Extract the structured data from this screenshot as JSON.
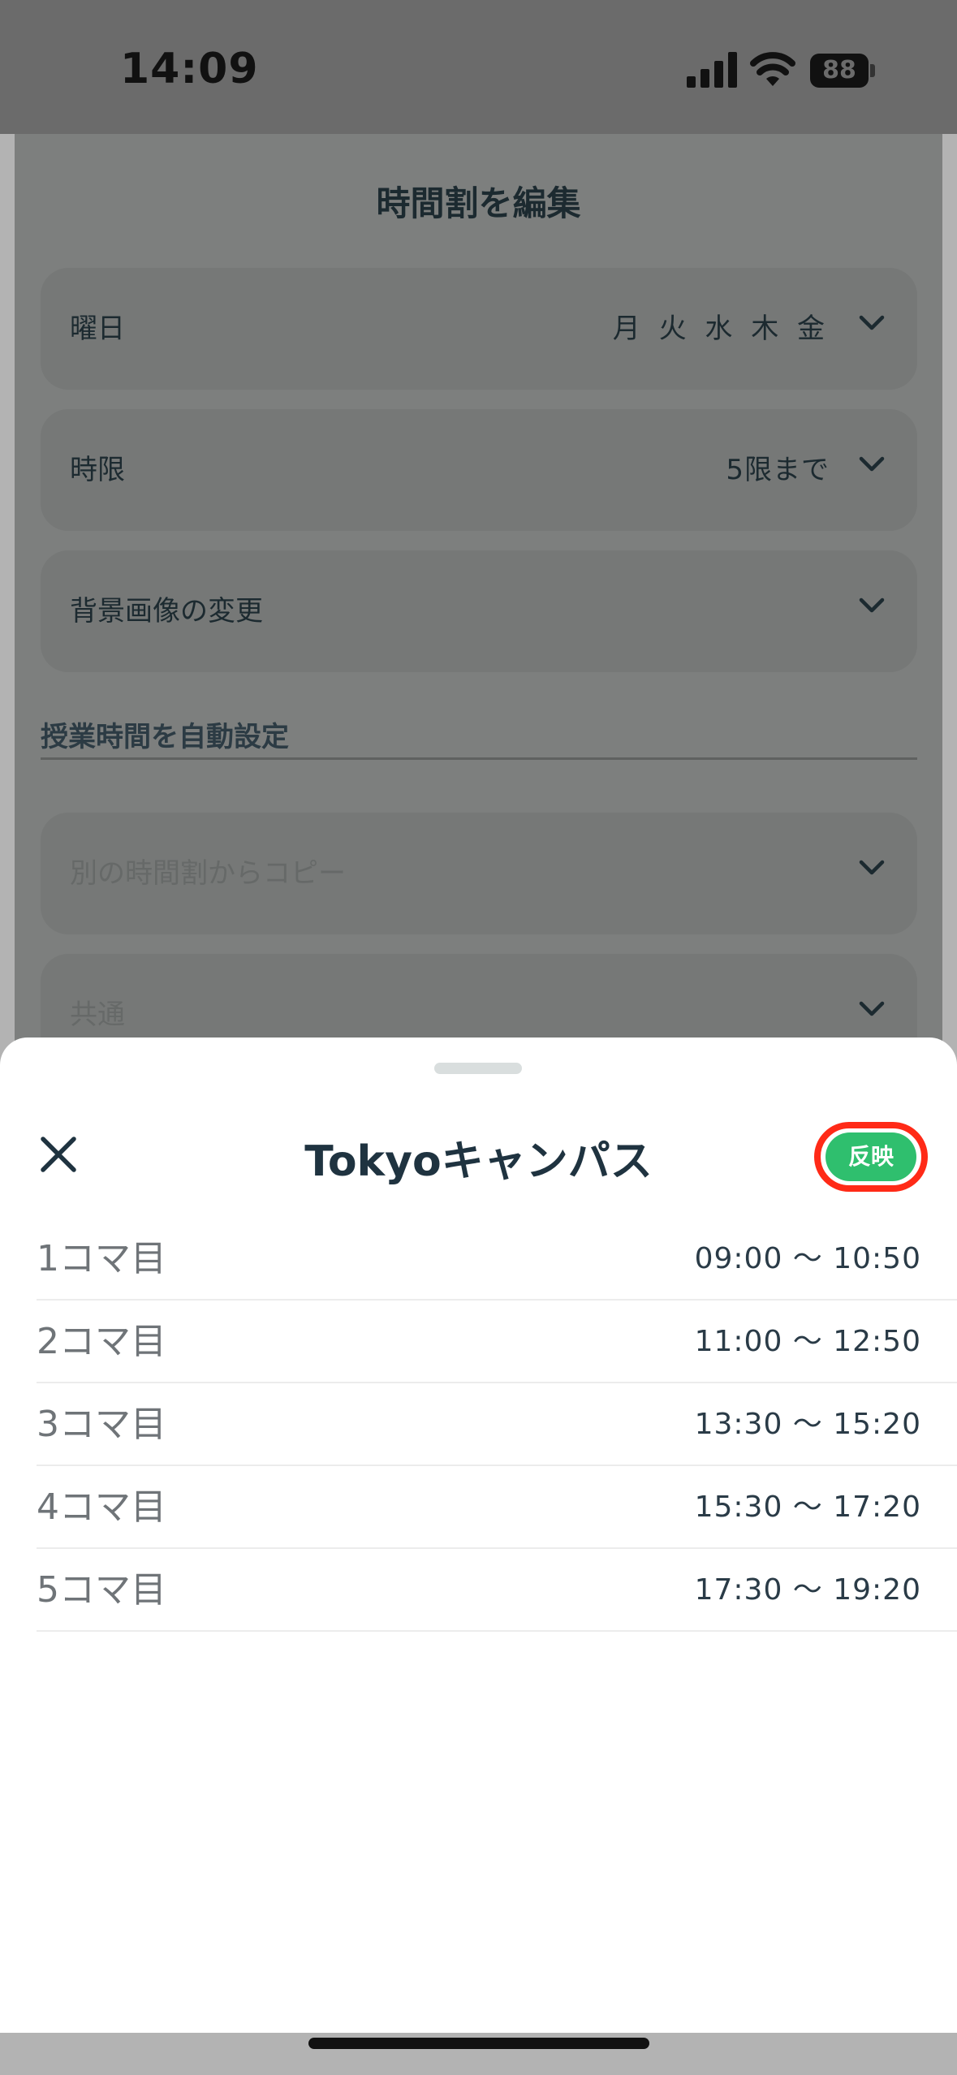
{
  "status_bar": {
    "time": "14:09",
    "battery": "88"
  },
  "page": {
    "title": "時間割を編集",
    "rows": [
      {
        "label": "曜日",
        "value": "月 火 水 木 金"
      },
      {
        "label": "時限",
        "value": "5限まで"
      },
      {
        "label": "背景画像の変更",
        "value": ""
      }
    ],
    "section_header": "授業時間を自動設定",
    "auto_rows": [
      {
        "label": "別の時間割からコピー"
      },
      {
        "label": "共通"
      }
    ]
  },
  "sheet": {
    "title": "Tokyoキャンパス",
    "apply_label": "反映",
    "periods": [
      {
        "name": "1コマ目",
        "time": "09:00 ～ 10:50"
      },
      {
        "name": "2コマ目",
        "time": "11:00 ～ 12:50"
      },
      {
        "name": "3コマ目",
        "time": "13:30 ～ 15:20"
      },
      {
        "name": "4コマ目",
        "time": "15:30 ～ 17:20"
      },
      {
        "name": "5コマ目",
        "time": "17:30 ～ 19:20"
      }
    ]
  },
  "colors": {
    "apply_button": "#2fbf6e",
    "highlight_ring": "#ff2a17",
    "text_primary": "#1f3340"
  },
  "icons": [
    "signal-icon",
    "wifi-icon",
    "battery-icon",
    "chevron-down-icon",
    "close-icon"
  ]
}
